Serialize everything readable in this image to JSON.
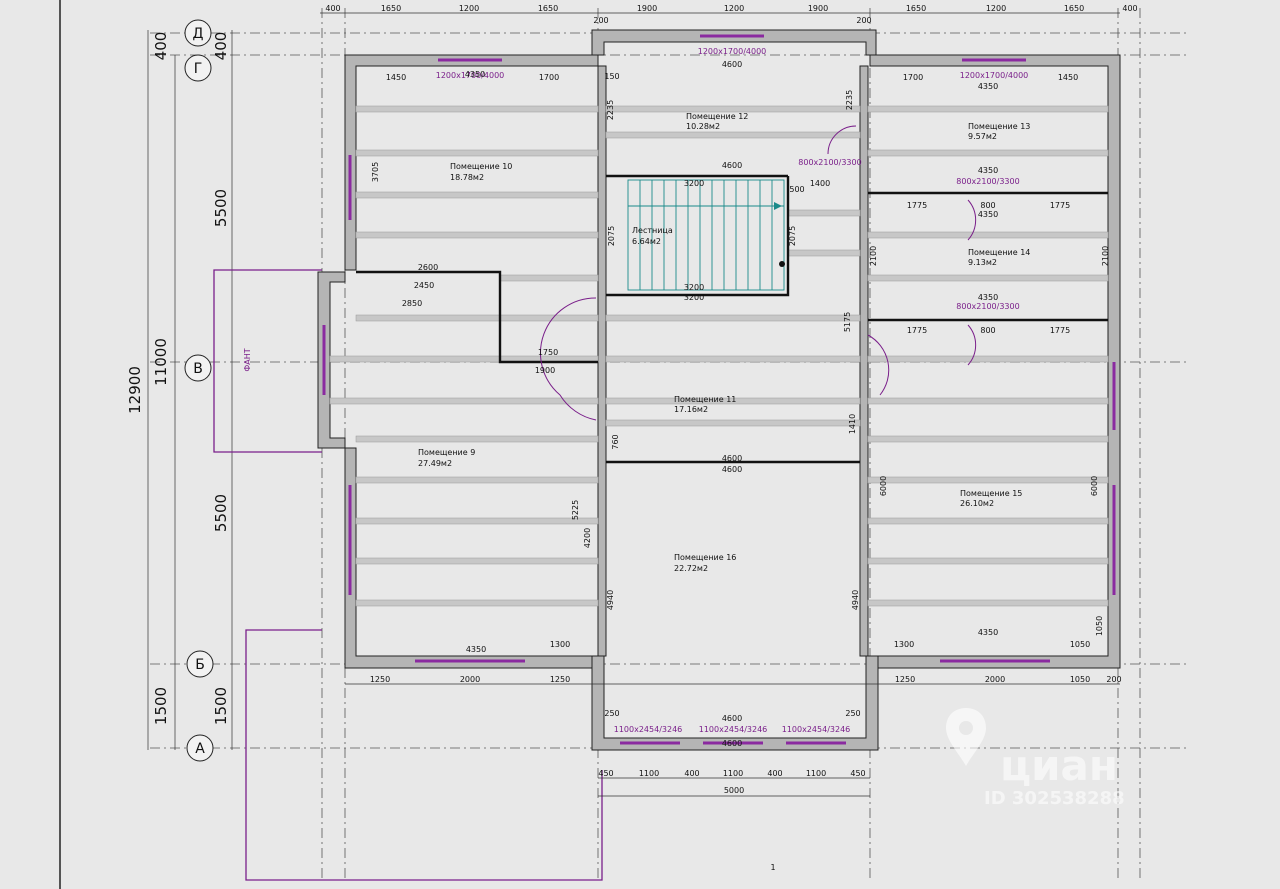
{
  "axes": [
    {
      "label": "Д"
    },
    {
      "label": "Г"
    },
    {
      "label": "В"
    },
    {
      "label": "Б"
    },
    {
      "label": "А"
    }
  ],
  "left_dims_big": [
    "400",
    "400",
    "5500",
    "11000",
    "12900",
    "5500",
    "1500",
    "1500"
  ],
  "top_dims": [
    "400",
    "1650",
    "1200",
    "1650",
    "200",
    "1900",
    "1200",
    "1900",
    "200",
    "1650",
    "1200",
    "1650",
    "400"
  ],
  "bottom_dims": [
    "1250",
    "2000",
    "1250",
    "450",
    "1100",
    "400",
    "1100",
    "400",
    "1100",
    "450",
    "1250",
    "2000",
    "1050",
    "200",
    "5000",
    "4600"
  ],
  "rooms": [
    {
      "name": "Помещение 10",
      "area": "18.78м2"
    },
    {
      "name": "Помещение 12",
      "area": "10.28м2"
    },
    {
      "name": "Помещение 13",
      "area": "9.57м2"
    },
    {
      "name": "Лестница",
      "area": "6.64м2"
    },
    {
      "name": "Помещение 14",
      "area": "9.13м2"
    },
    {
      "name": "Помещение 11",
      "area": "17.16м2"
    },
    {
      "name": "Помещение 9",
      "area": "27.49м2"
    },
    {
      "name": "Помещение 15",
      "area": "26.10м2"
    },
    {
      "name": "Помещение 16",
      "area": "22.72м2"
    }
  ],
  "windows": [
    {
      "label": "1200x1700/4000"
    },
    {
      "label": "1200x1700/4000"
    },
    {
      "label": "1200x1700/4000"
    },
    {
      "label": "1100x2454/3246"
    },
    {
      "label": "1100x2454/3246"
    },
    {
      "label": "1100x2454/3246"
    },
    {
      "label": "800x2100/3300"
    },
    {
      "label": "800x2100/3300"
    },
    {
      "label": "800x2100/3300"
    }
  ],
  "misc_labels": {
    "facade": "ФАНТ",
    "sheet": "1",
    "watermark_brand": "циан",
    "watermark_id": "ID 302538288"
  },
  "inner_dims": [
    "4350",
    "1450",
    "1700",
    "150",
    "4600",
    "1700",
    "4350",
    "1450",
    "3705",
    "2235",
    "2235",
    "4600",
    "4350",
    "3200",
    "500",
    "1400",
    "4350",
    "1775",
    "800",
    "1775",
    "2075",
    "2075",
    "2100",
    "2100",
    "2600",
    "2450",
    "2850",
    "3200",
    "3200",
    "4350",
    "1775",
    "800",
    "1775",
    "1750",
    "1900",
    "5175",
    "1410",
    "760",
    "4600",
    "4600",
    "6000",
    "6000",
    "5225",
    "4200",
    "4940",
    "4940",
    "4350",
    "1050",
    "1300",
    "4350",
    "1300",
    "1050",
    "4600",
    "250",
    "250"
  ],
  "colors": {
    "background": "#e8e8e8",
    "wall": "#b5b5b5",
    "window": "#8a2aa0",
    "stair": "#1a8a8a",
    "text": "#111111"
  }
}
